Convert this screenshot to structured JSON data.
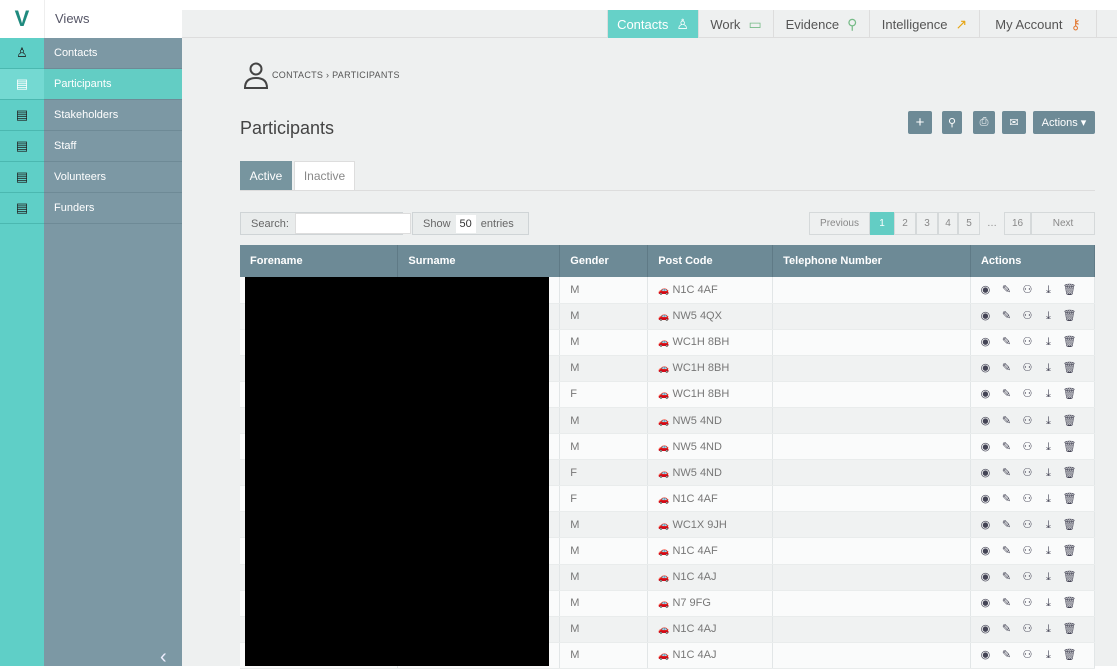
{
  "app": {
    "logo": "V",
    "views_label": "Views"
  },
  "topnav": [
    {
      "label": "Contacts",
      "icon": "person-icon",
      "glyph": "♙",
      "active": true
    },
    {
      "label": "Work",
      "icon": "folder-icon",
      "glyph": "▭",
      "active": false
    },
    {
      "label": "Evidence",
      "icon": "search-icon",
      "glyph": "⚲",
      "active": false
    },
    {
      "label": "Intelligence",
      "icon": "chart-icon",
      "glyph": "↗",
      "active": false
    },
    {
      "label": "My Account",
      "icon": "key-icon",
      "glyph": "⚷",
      "active": false
    }
  ],
  "sidebar": {
    "items": [
      {
        "label": "Contacts",
        "glyph": "♙"
      },
      {
        "label": "Participants",
        "glyph": "▤"
      },
      {
        "label": "Stakeholders",
        "glyph": "▤"
      },
      {
        "label": "Staff",
        "glyph": "▤"
      },
      {
        "label": "Volunteers",
        "glyph": "▤"
      },
      {
        "label": "Funders",
        "glyph": "▤"
      }
    ],
    "active_index": 1,
    "collapse_glyph": "‹"
  },
  "breadcrumb": "CONTACTS  ›  PARTICIPANTS",
  "page_title": "Participants",
  "toolbar": {
    "add": "+",
    "search": "⚲",
    "print": "⎙",
    "mail": "✉",
    "actions": "Actions ▾"
  },
  "tabs": {
    "active": "Active",
    "inactive": "Inactive"
  },
  "search": {
    "label": "Search:",
    "placeholder": ""
  },
  "show": {
    "prefix": "Show",
    "value": "50",
    "suffix": "entries"
  },
  "pagination": {
    "previous": "Previous",
    "pages": [
      "1",
      "2",
      "3",
      "4",
      "5",
      "…",
      "16"
    ],
    "next": "Next",
    "current": "1"
  },
  "table": {
    "headers": [
      "Forename",
      "Surname",
      "Gender",
      "Post Code",
      "Telephone Number",
      "Actions"
    ],
    "rows": [
      {
        "gender": "M",
        "postcode": "N1C 4AF"
      },
      {
        "gender": "M",
        "postcode": "NW5 4QX"
      },
      {
        "gender": "M",
        "postcode": "WC1H 8BH"
      },
      {
        "gender": "M",
        "postcode": "WC1H 8BH"
      },
      {
        "gender": "F",
        "postcode": "WC1H 8BH"
      },
      {
        "gender": "M",
        "postcode": "NW5 4ND"
      },
      {
        "gender": "M",
        "postcode": "NW5 4ND"
      },
      {
        "gender": "F",
        "postcode": "NW5 4ND"
      },
      {
        "gender": "F",
        "postcode": "N1C 4AF"
      },
      {
        "gender": "M",
        "postcode": "WC1X 9JH"
      },
      {
        "gender": "M",
        "postcode": "N1C 4AF"
      },
      {
        "gender": "M",
        "postcode": "N1C 4AJ"
      },
      {
        "gender": "M",
        "postcode": "N7 9FG"
      },
      {
        "gender": "M",
        "postcode": "N1C 4AJ"
      },
      {
        "gender": "M",
        "postcode": "N1C 4AJ"
      }
    ],
    "row_action_icons": [
      "view-icon",
      "edit-icon",
      "group-icon",
      "download-icon",
      "delete-icon"
    ],
    "row_action_glyphs": [
      "◉",
      "✎",
      "⚇",
      "⤓",
      "🗑"
    ],
    "postcode_glyph": "🚗"
  },
  "colors": {
    "accent": "#63cdc4",
    "sidebar": "#7c98a4",
    "header": "#6d8a96"
  }
}
